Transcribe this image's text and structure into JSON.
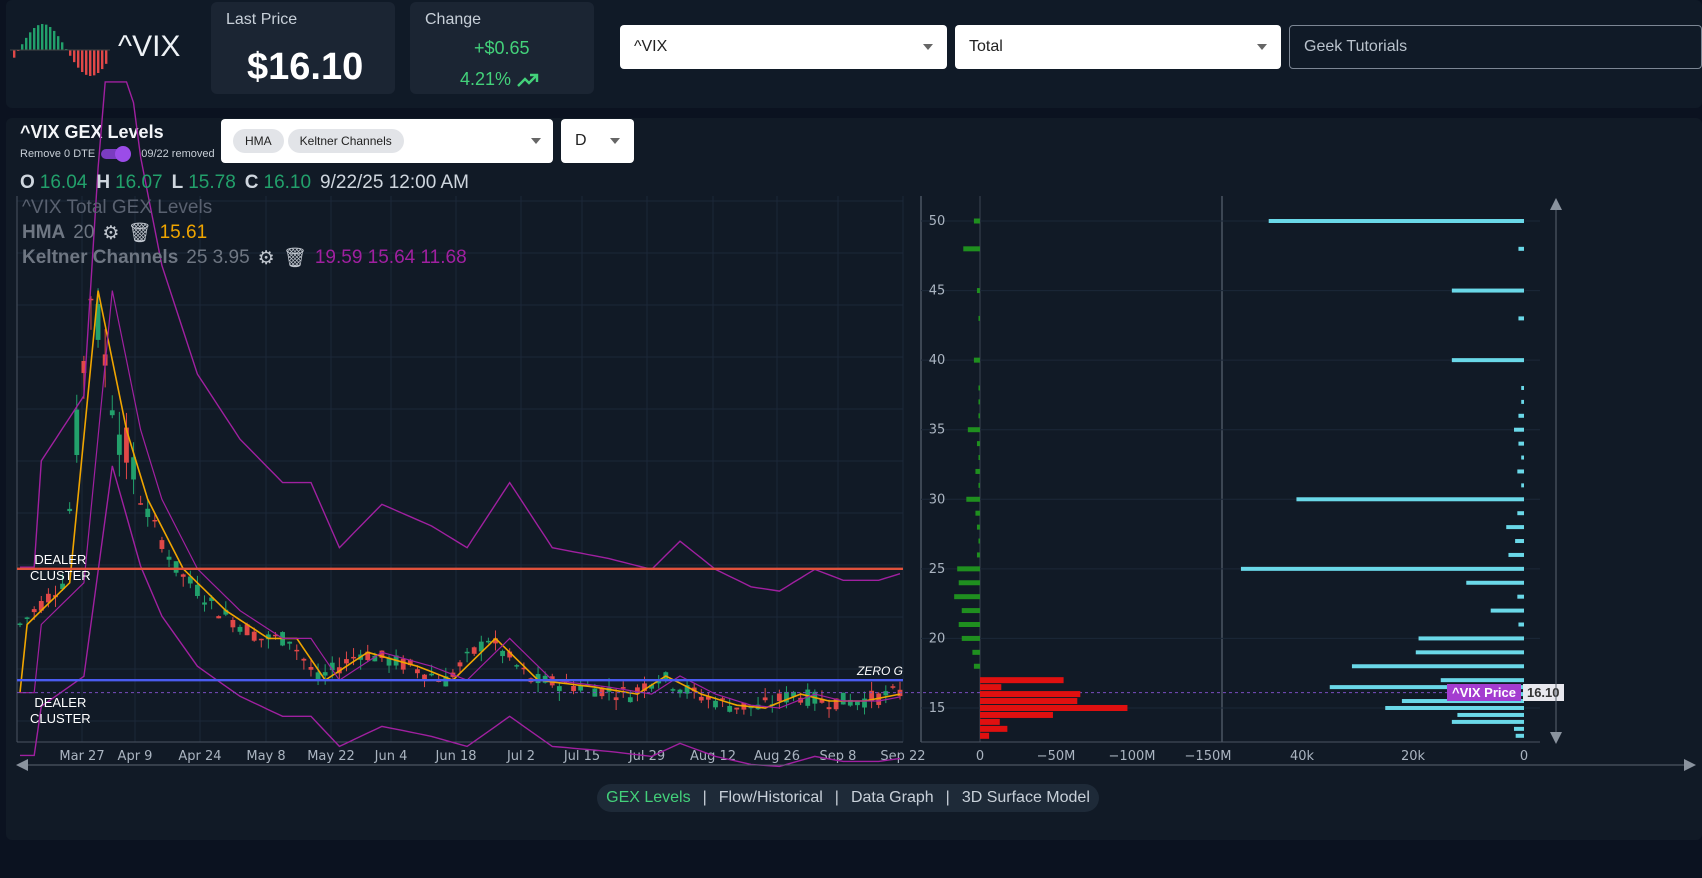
{
  "ticker": {
    "symbol": "^VIX"
  },
  "last_price": {
    "label": "Last Price",
    "value": "$16.10"
  },
  "change": {
    "label": "Change",
    "abs": "+$0.65",
    "pct": "4.21%"
  },
  "controls": {
    "symbol_select": "^VIX",
    "type_select": "Total",
    "tutorials": "Geek Tutorials"
  },
  "panel": {
    "title": "^VIX GEX Levels",
    "remove_label": "Remove 0 DTE",
    "removed_label": "09/22 removed",
    "indicators": [
      "HMA",
      "Keltner Channels"
    ],
    "interval": "D",
    "ohlc": {
      "o_label": "O",
      "o": "16.04",
      "h_label": "H",
      "h": "16.07",
      "l_label": "L",
      "l": "15.78",
      "c_label": "C",
      "c": "16.10",
      "datetime": "9/22/25 12:00 AM"
    },
    "legend_title": "^VIX Total GEX Levels",
    "hma": {
      "label": "HMA",
      "period": "20",
      "value": "15.61"
    },
    "keltner": {
      "label": "Keltner Channels",
      "params": "25 3.95",
      "values": "19.59 15.64 11.68"
    },
    "annotations": {
      "dealer_cluster_top": [
        "DEALER",
        "CLUSTER"
      ],
      "dealer_cluster_bottom": [
        "DEALER",
        "CLUSTER"
      ],
      "zero_g": "ZERO G"
    },
    "price_tag": {
      "label": "^VIX Price",
      "value": "16.10"
    }
  },
  "colors": {
    "up": "#22a06b",
    "down": "#e04848",
    "hma": "#f0a500",
    "keltner": "#a020a0",
    "dealer_line": "#e0523c",
    "zero_line": "#4a5cf0",
    "gex_pos": "#1f8f1f",
    "gex_neg": "#e01010",
    "oi": "#6ad8e8",
    "price_tag": "#a43cd0"
  },
  "chart_data": {
    "type": "bar",
    "x_dates": [
      "Mar 27",
      "Apr 9",
      "Apr 24",
      "May 8",
      "May 22",
      "Jun 4",
      "Jun 18",
      "Jul 2",
      "Jul 15",
      "Jul 29",
      "Aug 12",
      "Aug 26",
      "Sep 8",
      "Sep 22"
    ],
    "strikes": [
      50,
      48,
      45,
      43,
      40,
      38,
      37,
      36,
      35,
      34,
      33,
      32,
      31,
      30,
      29,
      28,
      27,
      26,
      25,
      24,
      23,
      22,
      21,
      20,
      19,
      18,
      17,
      16.5,
      16,
      15.5,
      15,
      14.5,
      14,
      13.5,
      13
    ],
    "strike_ticks": [
      50,
      45,
      40,
      35,
      30,
      25,
      20,
      15
    ],
    "gex_ticks": [
      "0",
      "−50M",
      "−100M",
      "−150M"
    ],
    "gex_values_m": [
      -4,
      -11,
      -2,
      -1,
      -4,
      -1,
      -1,
      -1,
      -8,
      -2,
      -1,
      -3,
      -1,
      -9,
      -3,
      -2,
      -1,
      -2,
      -15,
      -14,
      -17,
      -12,
      -14,
      -12,
      -5,
      -4,
      55,
      14,
      66,
      64,
      97,
      48,
      13,
      18,
      6
    ],
    "oi_ticks": [
      "40k",
      "20k",
      "0"
    ],
    "oi_values_k": [
      46,
      1,
      13,
      1,
      13,
      0.5,
      0.5,
      1,
      1.8,
      1,
      0.5,
      1.2,
      0.5,
      41,
      1.2,
      3.2,
      1.6,
      2.8,
      51,
      10.4,
      1.2,
      6,
      1,
      19,
      19.5,
      31,
      15,
      35,
      6,
      22,
      25,
      12,
      13,
      1.8,
      1.5
    ],
    "dealer_cluster_levels": [
      25,
      17.0
    ],
    "zero_gamma": 17.0,
    "price": 16.1,
    "ylim_strike": [
      12.5,
      51.5
    ]
  },
  "footer_tabs": [
    "GEX Levels",
    "Flow/Historical",
    "Data Graph",
    "3D Surface Model"
  ]
}
